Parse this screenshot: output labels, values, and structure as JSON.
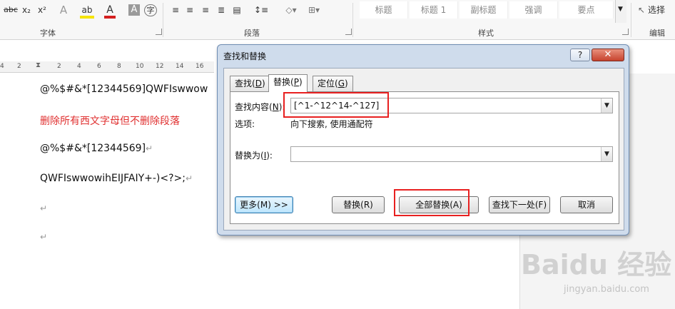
{
  "ribbon": {
    "font_tools": [
      {
        "label": "abc",
        "icon": "strikethrough-icon"
      },
      {
        "label": "x₂",
        "icon": "subscript-icon"
      },
      {
        "label": "x²",
        "icon": "superscript-icon"
      },
      {
        "label": "A",
        "icon": "text-effects-icon"
      },
      {
        "label": "ab",
        "icon": "highlight-icon"
      },
      {
        "label": "A",
        "icon": "font-color-icon"
      },
      {
        "label": "A",
        "icon": "character-shading-icon"
      },
      {
        "label": "字",
        "icon": "enclose-characters-icon"
      }
    ],
    "font_group_label": "字体",
    "paragraph_group_label": "段落",
    "styles": [
      "标题",
      "标题 1",
      "副标题",
      "强调",
      "要点"
    ],
    "styles_group_label": "样式",
    "select_label": "选择",
    "editing_group_label": "编辑",
    "highlight_color": "#f5e400",
    "font_color": "#d42020"
  },
  "ruler": {
    "ticks": [
      "4",
      "2",
      "2",
      "4",
      "6",
      "8",
      "10",
      "12",
      "14",
      "16"
    ]
  },
  "document": {
    "lines": [
      {
        "text": "@%$#&*[12344569]QWFIswwow",
        "color": "#111111"
      },
      {
        "text": "删除所有西文字母但不删除段落",
        "color": "#e03030"
      },
      {
        "text": "@%$#&*[12344569]",
        "color": "#111111"
      },
      {
        "text": "QWFIswwowihEIJFAIY+-)<?>;",
        "color": "#111111"
      }
    ],
    "paragraph_mark": "↵"
  },
  "dialog": {
    "title": "查找和替换",
    "help_label": "?",
    "close_label": "✕",
    "tabs": [
      {
        "label": "查找",
        "key": "D"
      },
      {
        "label": "替换",
        "key": "P"
      },
      {
        "label": "定位",
        "key": "G"
      }
    ],
    "active_tab": "替换",
    "find_label": "查找内容",
    "find_key": "N",
    "find_value": "[^1-^12^14-^127]",
    "options_label": "选项:",
    "options_value": "向下搜索, 使用通配符",
    "replace_label": "替换为",
    "replace_key": "I",
    "replace_value": "",
    "buttons": {
      "more": "更多(M) >>",
      "replace": "替换(R)",
      "replace_all": "全部替换(A)",
      "find_next": "查找下一处(F)",
      "cancel": "取消"
    },
    "highlight_color": "#e82020"
  },
  "watermark": {
    "logo": "Baidu 经验",
    "sub": "jingyan.baidu.com"
  }
}
